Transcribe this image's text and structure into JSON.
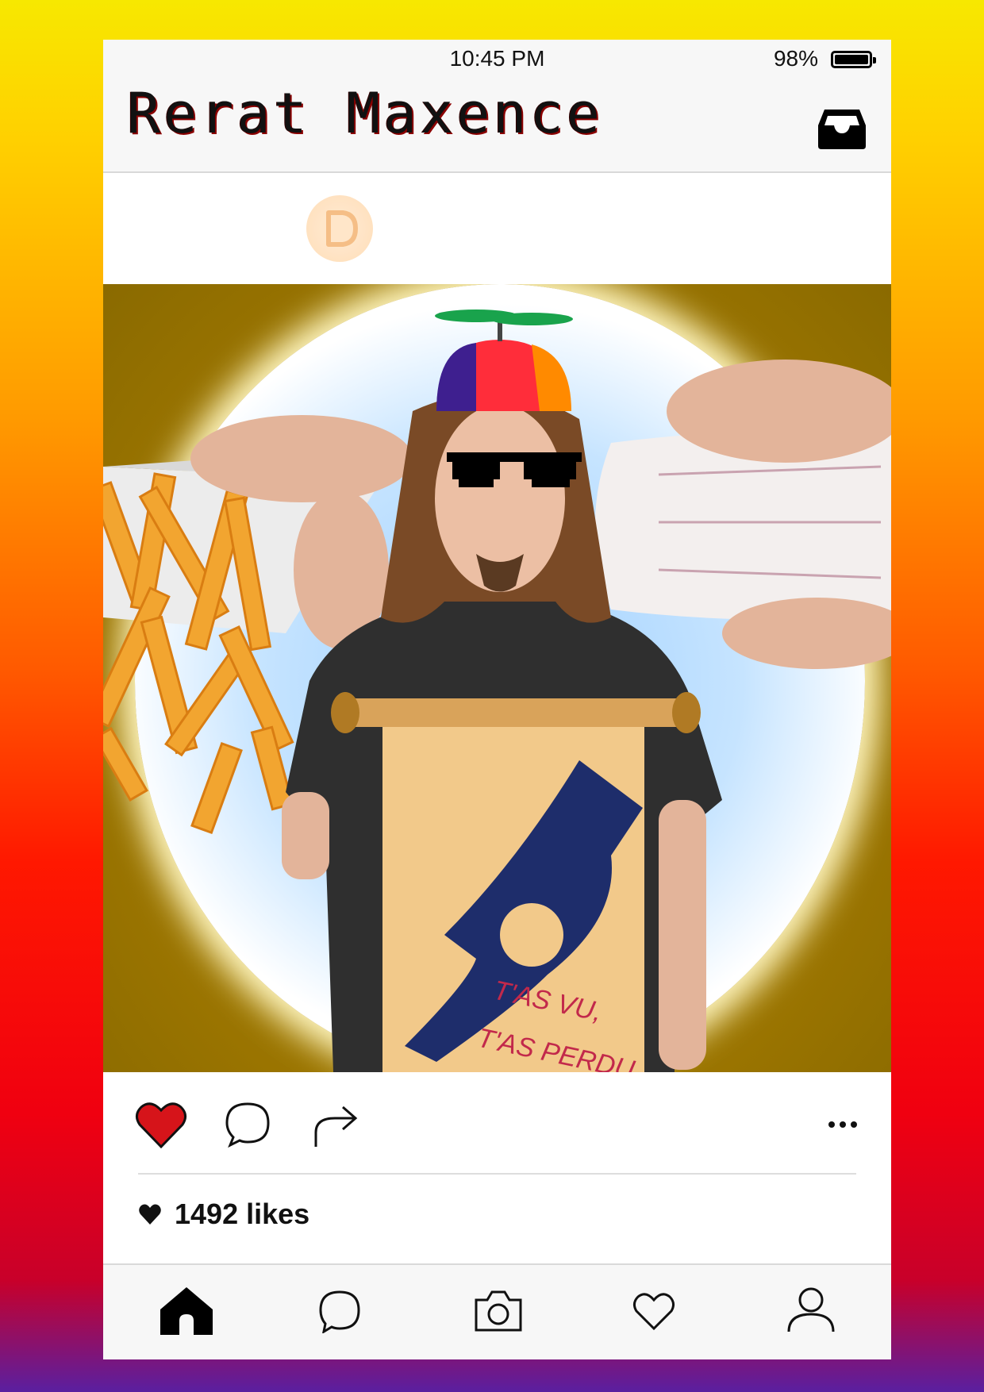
{
  "status_bar": {
    "time": "10:45 PM",
    "battery": "98%"
  },
  "header": {
    "profile_name": "Rerat Maxence"
  },
  "post": {
    "scroll_text_line1": "T'AS VU,",
    "scroll_text_line2": "T'AS PERDU",
    "likes": "1492 likes"
  },
  "icons": {
    "header": [
      "inbox-icon"
    ],
    "actions": [
      "heart-icon",
      "comment-icon",
      "share-icon",
      "more-icon"
    ],
    "tabbar": [
      "home-icon",
      "search-icon",
      "camera-icon",
      "heart-outline-icon",
      "profile-icon"
    ]
  },
  "colors": {
    "like_red": "#d6141a",
    "background_top": "#f7e800",
    "background_bottom": "#5a1fa0"
  }
}
